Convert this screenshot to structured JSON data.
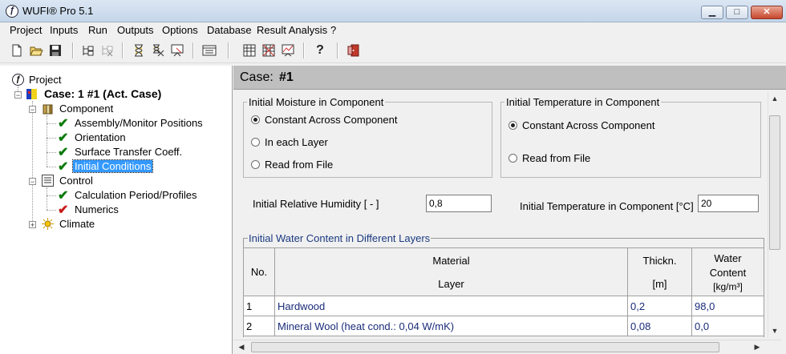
{
  "window": {
    "title": "WUFI® Pro 5.1",
    "min_glyph": "▁",
    "max_glyph": "□",
    "close_glyph": "✕"
  },
  "menu": [
    "Project",
    "Inputs",
    "Run",
    "Outputs",
    "Options",
    "Database",
    "Result Analysis",
    "?"
  ],
  "toolbar": {
    "icons": [
      "new-file-icon",
      "open-folder-icon",
      "save-disk-icon",
      "tree-add-icon",
      "tree-remove-icon",
      "hourglass-run-icon",
      "hourglass-multi-icon",
      "calculation-icon",
      "profile-table-icon",
      "grid-table-icon",
      "grid-cross-icon",
      "grid-chart-icon",
      "help-question-icon",
      "exit-door-icon"
    ],
    "help_glyph": "?"
  },
  "tree": {
    "root": "Project",
    "case": "Case: 1 #1 (Act. Case)",
    "component": "Component",
    "component_children": [
      "Assembly/Monitor Positions",
      "Orientation",
      "Surface Transfer Coeff.",
      "Initial Conditions"
    ],
    "control": "Control",
    "control_children": [
      "Calculation Period/Profiles",
      "Numerics"
    ],
    "climate": "Climate",
    "check_glyph": "✔",
    "minus_glyph": "−",
    "plus_glyph": "+"
  },
  "case_header": {
    "label": "Case:",
    "value": "#1"
  },
  "moisture": {
    "legend": "Initial Moisture in Component",
    "options": [
      "Constant Across Component",
      "In each Layer",
      "Read from File"
    ],
    "selected": 0
  },
  "temperature": {
    "legend": "Initial Temperature in Component",
    "options": [
      "Constant Across Component",
      "Read from File"
    ],
    "selected": 0
  },
  "rh": {
    "label": "Initial Relative Humidity [ - ]",
    "value": "0,8"
  },
  "temp_input": {
    "label": "Initial Temperature in Component [°C]",
    "value": "20"
  },
  "water_content": {
    "legend": "Initial Water Content in Different Layers",
    "headers": {
      "no": "No.",
      "material": "Material",
      "layer": "Layer",
      "thickness": "Thickn.",
      "thickness_unit": "[m]",
      "water": "Water",
      "water2": "Content",
      "water_unit": "[kg/m³]"
    },
    "rows": [
      {
        "no": "1",
        "material": "Hardwood",
        "thickness": "0,2",
        "water": "98,0"
      },
      {
        "no": "2",
        "material": "Mineral Wool (heat cond.: 0,04 W/mK)",
        "thickness": "0,08",
        "water": "0,0"
      }
    ]
  },
  "scroll_glyphs": {
    "up": "▲",
    "down": "▼",
    "left": "◀",
    "right": "▶"
  }
}
